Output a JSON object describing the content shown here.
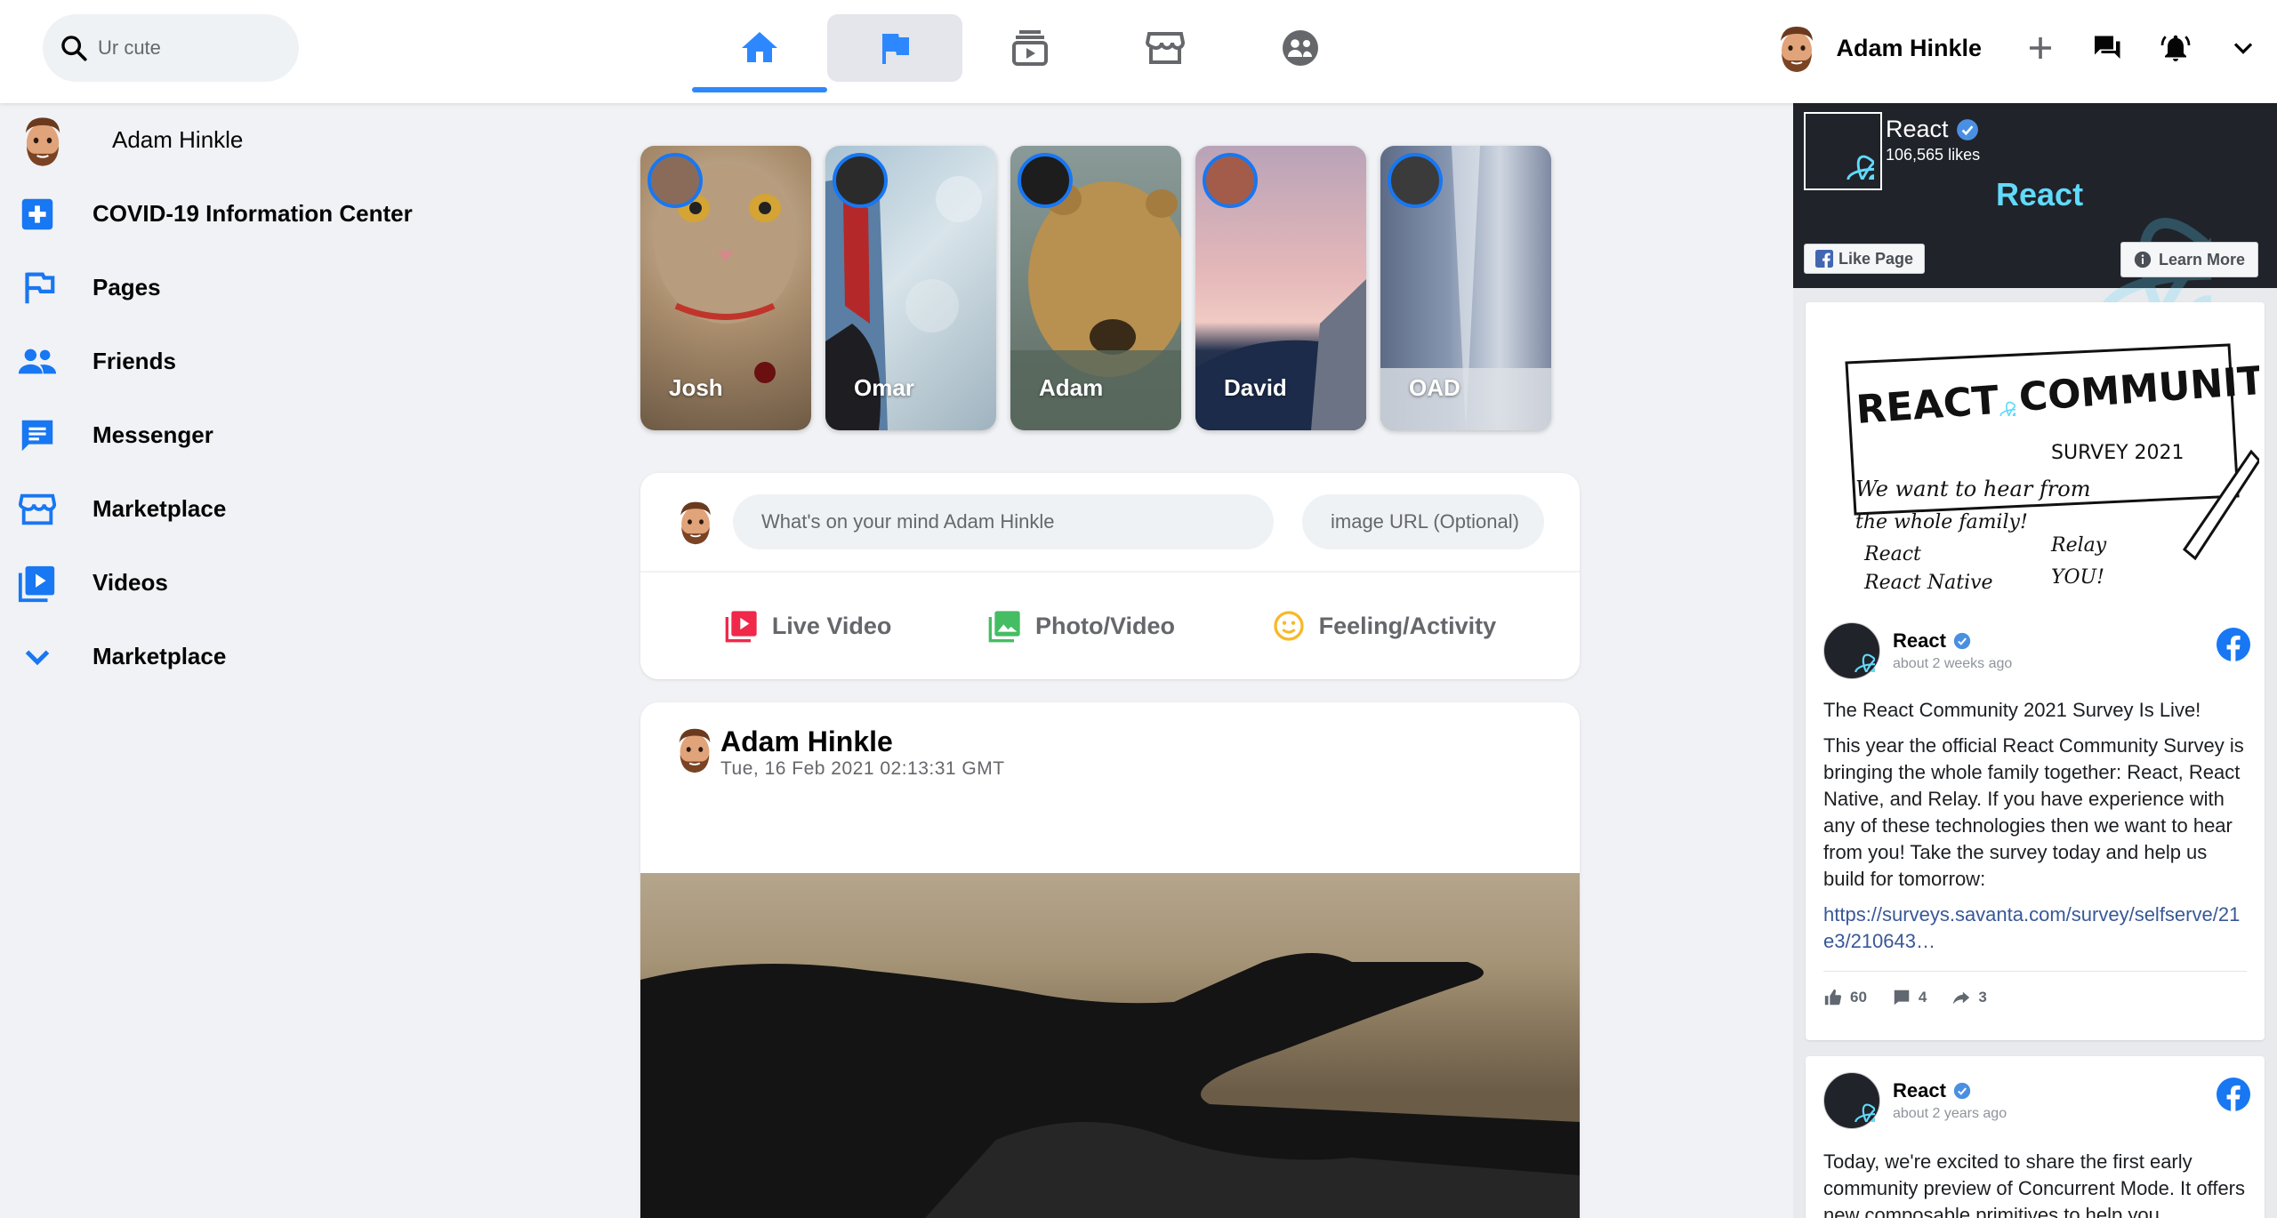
{
  "header": {
    "search_placeholder": "Ur cute",
    "user_name": "Adam Hinkle",
    "accent_color": "#2d88ff",
    "nav_icons": [
      "home-icon",
      "flag-icon",
      "subscriptions-icon",
      "storefront-icon",
      "supervised-account-icon"
    ],
    "right_icons": [
      "add-icon",
      "forum-icon",
      "notifications-active-icon",
      "expand-more-icon"
    ]
  },
  "sidebar": {
    "user_name": "Adam Hinkle",
    "items": [
      {
        "label": "COVID-19 Information Center",
        "icon": "local-hospital-icon"
      },
      {
        "label": "Pages",
        "icon": "emoji-flags-icon"
      },
      {
        "label": "Friends",
        "icon": "people-icon"
      },
      {
        "label": "Messenger",
        "icon": "chat-icon"
      },
      {
        "label": "Marketplace",
        "icon": "storefront-icon"
      },
      {
        "label": "Videos",
        "icon": "video-library-icon"
      },
      {
        "label": "Marketplace",
        "icon": "expand-more-icon"
      }
    ]
  },
  "stories": [
    {
      "name": "Josh"
    },
    {
      "name": "Omar"
    },
    {
      "name": "Adam"
    },
    {
      "name": "David"
    },
    {
      "name": "OAD"
    }
  ],
  "composer": {
    "message_placeholder": "What's on your mind Adam Hinkle",
    "image_placeholder": "image URL (Optional)",
    "actions": [
      {
        "label": "Live Video",
        "color": "#f02849"
      },
      {
        "label": "Photo/Video",
        "color": "#45bd62"
      },
      {
        "label": "Feeling/Activity",
        "color": "#f7b928"
      }
    ]
  },
  "post": {
    "author": "Adam Hinkle",
    "timestamp": "Tue, 16 Feb 2021 02:13:31 GMT"
  },
  "widget": {
    "page_name": "React",
    "likes": "106,565 likes",
    "cover_word": "React",
    "like_page": "Like Page",
    "learn_more": "Learn More",
    "survey_image": {
      "title_left": "REACT",
      "title_right": "COMMUNITY",
      "subtitle": "SURVEY 2021",
      "line1": "We want to hear from",
      "line2": "the whole family!",
      "check1": "React",
      "check2": "React Native",
      "check3": "Relay",
      "check4": "YOU!"
    },
    "posts": [
      {
        "name": "React",
        "time": "about 2 weeks ago",
        "headline": "The React Community 2021 Survey Is Live!",
        "body": "This year the official React Community Survey is bringing the whole family together: React, React Native, and Relay. If you have experience with any of these technologies then we want to hear from you! Take the survey today and help us build for tomorrow:",
        "link": "https://surveys.savanta.com/survey/selfserve/21e3/210643…",
        "likes": "60",
        "comments": "4",
        "shares": "3"
      },
      {
        "name": "React",
        "time": "about 2 years ago",
        "body": "Today, we're excited to share the first early community preview of Concurrent Mode. It offers new composable primitives to help you"
      }
    ]
  }
}
